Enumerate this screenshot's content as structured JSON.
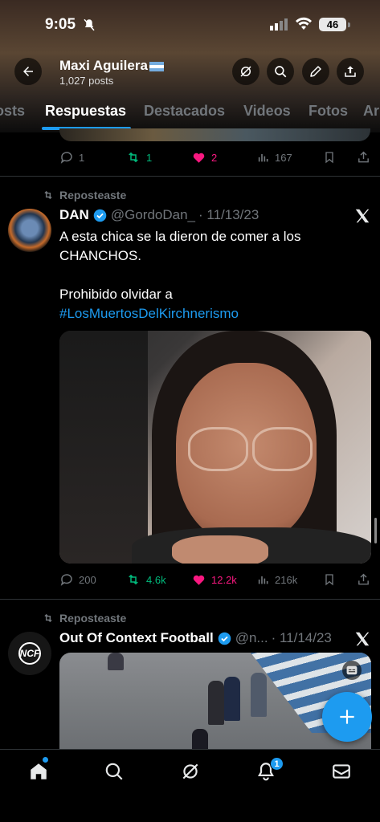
{
  "status_bar": {
    "time": "9:05",
    "battery": "46"
  },
  "profile": {
    "name": "Maxi Aguilera",
    "posts": "1,027 posts"
  },
  "tabs": [
    "osts",
    "Respuestas",
    "Destacados",
    "Videos",
    "Fotos",
    "Ar"
  ],
  "active_tab": "Respuestas",
  "prev_tweet": {
    "replies": "1",
    "reposts": "1",
    "likes": "2",
    "views": "167"
  },
  "tweet1": {
    "repost_label": "Reposteaste",
    "author": "DAN",
    "handle": "@GordoDan_",
    "date": "· 11/13/23",
    "text_line1": "A esta chica se la dieron de comer a los",
    "text_line2": "CHANCHOS.",
    "text_line3": "Prohibido olvidar a",
    "hashtag": "#LosMuertosDelKirchnerismo",
    "replies": "200",
    "reposts": "4.6k",
    "likes": "12.2k",
    "views": "216k"
  },
  "tweet2": {
    "repost_label": "Reposteaste",
    "author": "Out Of Context Football",
    "avatar_text": "NCF",
    "handle": "@n...",
    "date": "· 11/14/23"
  },
  "notifications_badge": "1",
  "colors": {
    "accent": "#1d9bf0",
    "like": "#f91880",
    "repost": "#00ba7c",
    "muted": "#71767b"
  }
}
